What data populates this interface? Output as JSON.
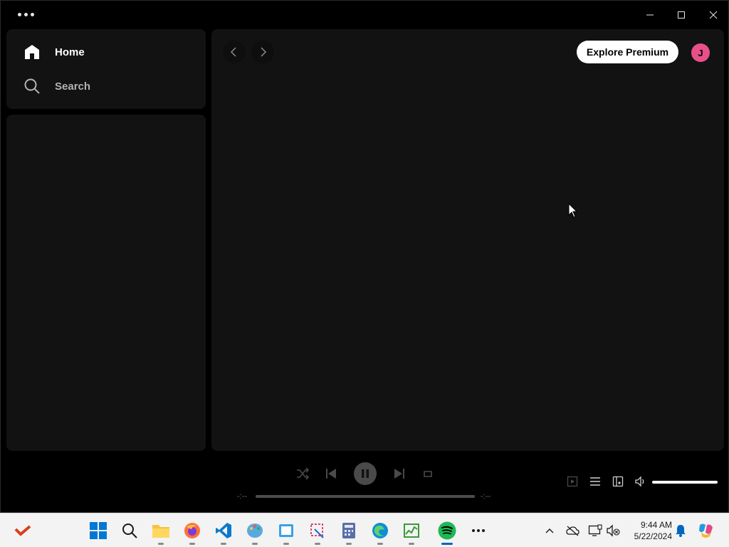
{
  "app": {
    "name": "Spotify",
    "window_controls": [
      "minimize",
      "maximize",
      "close"
    ]
  },
  "nav": {
    "items": [
      {
        "label": "Home",
        "icon": "home-icon"
      },
      {
        "label": "Search",
        "icon": "search-icon"
      }
    ]
  },
  "topbar": {
    "premium_label": "Explore Premium",
    "avatar_initial": "J"
  },
  "player": {
    "elapsed": "-:--",
    "remaining": "-:--",
    "state": "playing",
    "volume_fraction": 1.0
  },
  "taskbar": {
    "apps": [
      "start",
      "search",
      "file-explorer",
      "firefox",
      "vscode",
      "paint",
      "notepad",
      "snipping-tool",
      "calculator",
      "edge",
      "task-manager",
      "spotify",
      "more"
    ],
    "active_app": "spotify",
    "time": "9:44 AM",
    "date": "5/22/2024"
  },
  "colors": {
    "accent": "#1db954",
    "avatar": "#e8508a",
    "panel": "#121212"
  }
}
